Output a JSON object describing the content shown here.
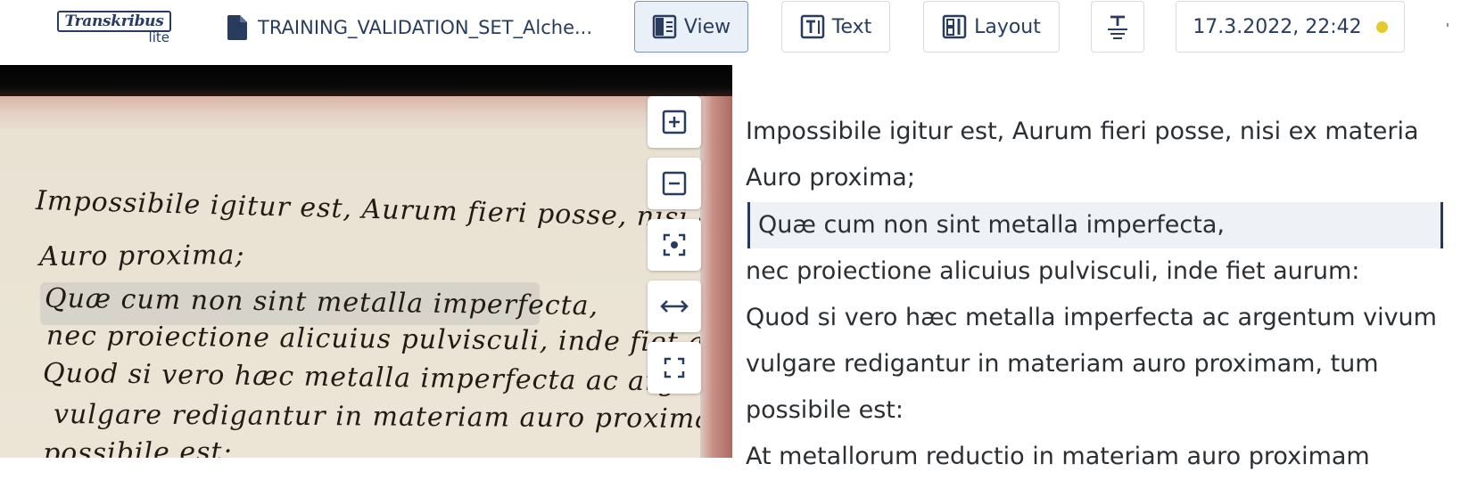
{
  "app": {
    "logo_text": "Transkribus",
    "logo_sub": "lite"
  },
  "toolbar": {
    "doc_title": "TRAINING_VALIDATION_SET_Alche...",
    "view_label": "View",
    "text_label": "Text",
    "layout_label": "Layout",
    "datetime": "17.3.2022, 22:42",
    "status_color": "#e6c92a"
  },
  "icons": {
    "doc": "file-icon",
    "view": "view-panel-icon",
    "text": "text-box-icon",
    "layout": "layout-icon",
    "format": "text-format-icon",
    "zoom_in": "zoom-in-icon",
    "zoom_out": "zoom-out-icon",
    "focus": "focus-icon",
    "fit_width": "fit-width-icon",
    "fullscreen": "fullscreen-icon"
  },
  "text_lines": [
    "Impossibile igitur est, Aurum fieri posse, nisi ex materia",
    "Auro proxima;",
    "Quæ cum non sint metalla imperfecta,",
    "nec proiectione alicuius pulvisculi, inde fiet aurum:",
    "Quod si vero hæc metalla imperfecta ac argentum vivum",
    "vulgare redigantur in materiam auro proximam, tum",
    "possibile est:",
    "At metallorum reductio in materiam auro proximam"
  ],
  "selected_line_index": 2
}
